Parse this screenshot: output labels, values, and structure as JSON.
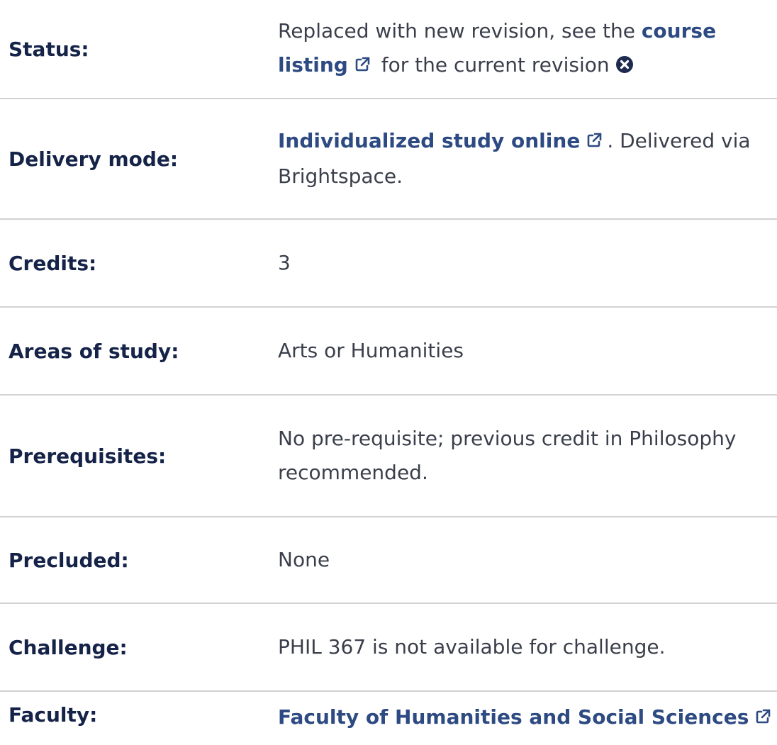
{
  "status": {
    "label": "Status:",
    "text_before": "Replaced with new revision, see the ",
    "link_text": "course listing",
    "text_after": " for the current revision",
    "link_icon": "external-link-icon",
    "status_icon": "circle-x-icon"
  },
  "delivery": {
    "label": "Delivery mode:",
    "link_text": "Individualized study online",
    "text_after": ". Delivered via Brightspace.",
    "link_icon": "external-link-icon"
  },
  "credits": {
    "label": "Credits:",
    "value": "3"
  },
  "areas": {
    "label": "Areas of study:",
    "value": "Arts or Humanities"
  },
  "prereq": {
    "label": "Prerequisites:",
    "value": "No pre-requisite; previous credit in Philosophy recommended."
  },
  "precluded": {
    "label": "Precluded:",
    "value": "None"
  },
  "challenge": {
    "label": "Challenge:",
    "value": "PHIL 367 is not available for challenge."
  },
  "faculty": {
    "label": "Faculty:",
    "link_text": "Faculty of Humanities and Social Sciences",
    "link_icon": "external-link-icon"
  },
  "colors": {
    "label": "#152348",
    "link": "#2d4a82",
    "text": "#3a3f4b",
    "divider": "#d2d2d2"
  }
}
